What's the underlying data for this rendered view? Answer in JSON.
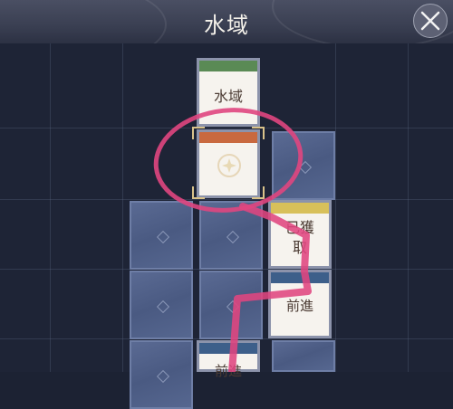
{
  "header": {
    "title": "水域",
    "close_icon": "close-x-icon"
  },
  "cards": {
    "water": {
      "label": "水域",
      "band_color": "#5a8a55"
    },
    "current": {
      "band_color": "#c9693f",
      "icon": "compass-star-icon"
    },
    "obtained": {
      "label_line1": "已獲",
      "label_line2": "取",
      "band_color": "#d8c05a"
    },
    "forward": {
      "label": "前進",
      "band_color": "#3d5f8a"
    },
    "bottom": {
      "label": "前進",
      "band_color": "#3d5f8a"
    }
  },
  "colors": {
    "annotation": "#e0467f",
    "card_back": "#536390",
    "header_bg": "#3a3f52"
  }
}
